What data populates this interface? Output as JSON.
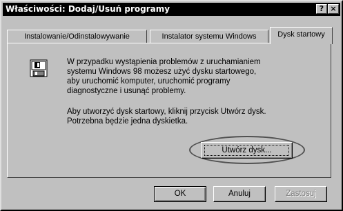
{
  "window": {
    "title": "Właściwości: Dodaj/Usuń programy",
    "help_glyph": "?",
    "close_glyph": "×"
  },
  "tabs": [
    {
      "label": "Instalowanie/Odinstalowywanie",
      "active": false
    },
    {
      "label": "Instalator systemu Windows",
      "active": false
    },
    {
      "label": "Dysk startowy",
      "active": true
    }
  ],
  "panel": {
    "icon": "floppy-disk-icon",
    "paragraph1": "W przypadku wystąpienia problemów z uruchamianiem\nsystemu Windows 98 możesz użyć dysku startowego,\naby uruchomić komputer, uruchomić programy\ndiagnostyczne i usunąć problemy.",
    "paragraph2": "Aby utworzyć dysk startowy, kliknij przycisk Utwórz dysk.\nPotrzebna będzie jedna dyskietka.",
    "create_button_label": "Utwórz dysk..."
  },
  "buttons": {
    "ok": "OK",
    "cancel": "Anuluj",
    "apply": "Zastosuj",
    "apply_enabled": false
  },
  "colors": {
    "title_bar": "#000000",
    "face": "#c0c0c0",
    "highlight_ring": "#505050"
  }
}
